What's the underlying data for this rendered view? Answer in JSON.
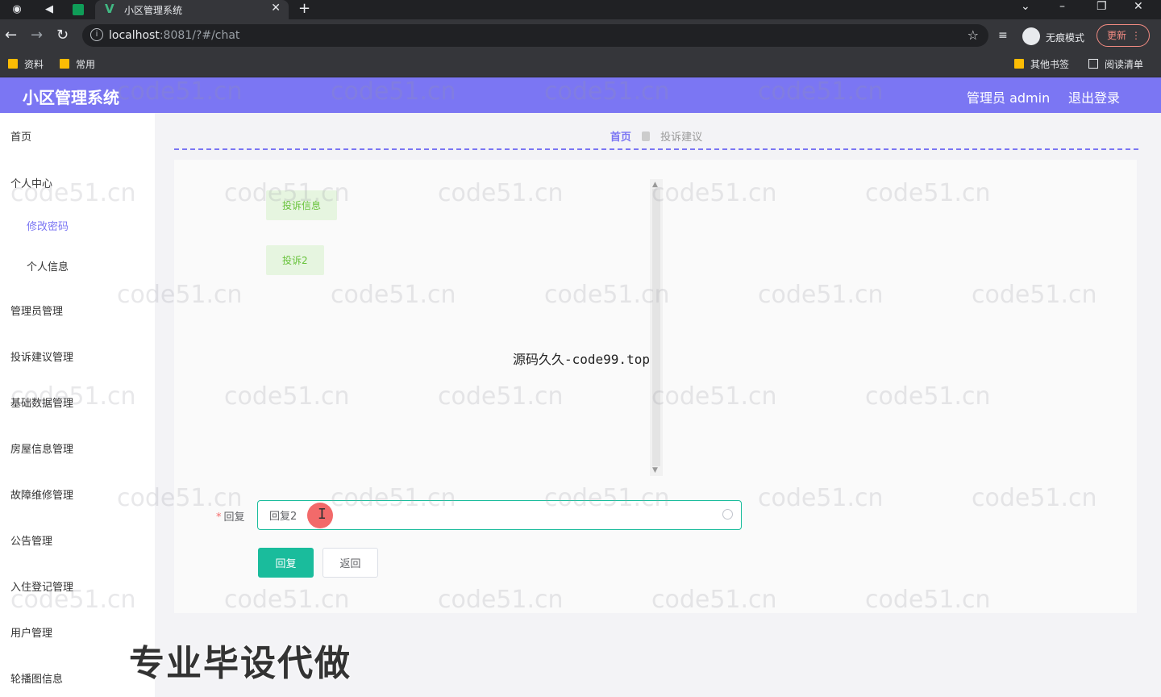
{
  "browser": {
    "tab_title": "小区管理系统",
    "url_host": "localhost",
    "url_rest": ":8081/?#/chat",
    "incognito_label": "无痕模式",
    "update_label": "更新",
    "bookmarks": [
      "资料",
      "常用"
    ],
    "bookmarks_right": [
      "其他书签",
      "阅读清单"
    ]
  },
  "header": {
    "title": "小区管理系统",
    "admin": "管理员 admin",
    "logout": "退出登录",
    "color": "#7b76f3"
  },
  "sidebar": {
    "items": [
      {
        "label": "首页"
      },
      {
        "label": "个人中心"
      },
      {
        "label": "修改密码"
      },
      {
        "label": "个人信息"
      },
      {
        "label": "管理员管理"
      },
      {
        "label": "投诉建议管理"
      },
      {
        "label": "基础数据管理"
      },
      {
        "label": "房屋信息管理"
      },
      {
        "label": "故障维修管理"
      },
      {
        "label": "公告管理"
      },
      {
        "label": "入住登记管理"
      },
      {
        "label": "用户管理"
      },
      {
        "label": "轮播图信息"
      }
    ]
  },
  "breadcrumb": {
    "home": "首页",
    "current": "投诉建议"
  },
  "chat": {
    "messages": [
      "投诉信息",
      "投诉2"
    ]
  },
  "form": {
    "reply_label": "回复",
    "required_mark": "*",
    "reply_value": "回复2",
    "submit_label": "回复",
    "back_label": "返回"
  },
  "overlays": {
    "center_text": "源码久久-code99.top",
    "promo_text": "专业毕设代做",
    "watermark": "code51.cn"
  }
}
